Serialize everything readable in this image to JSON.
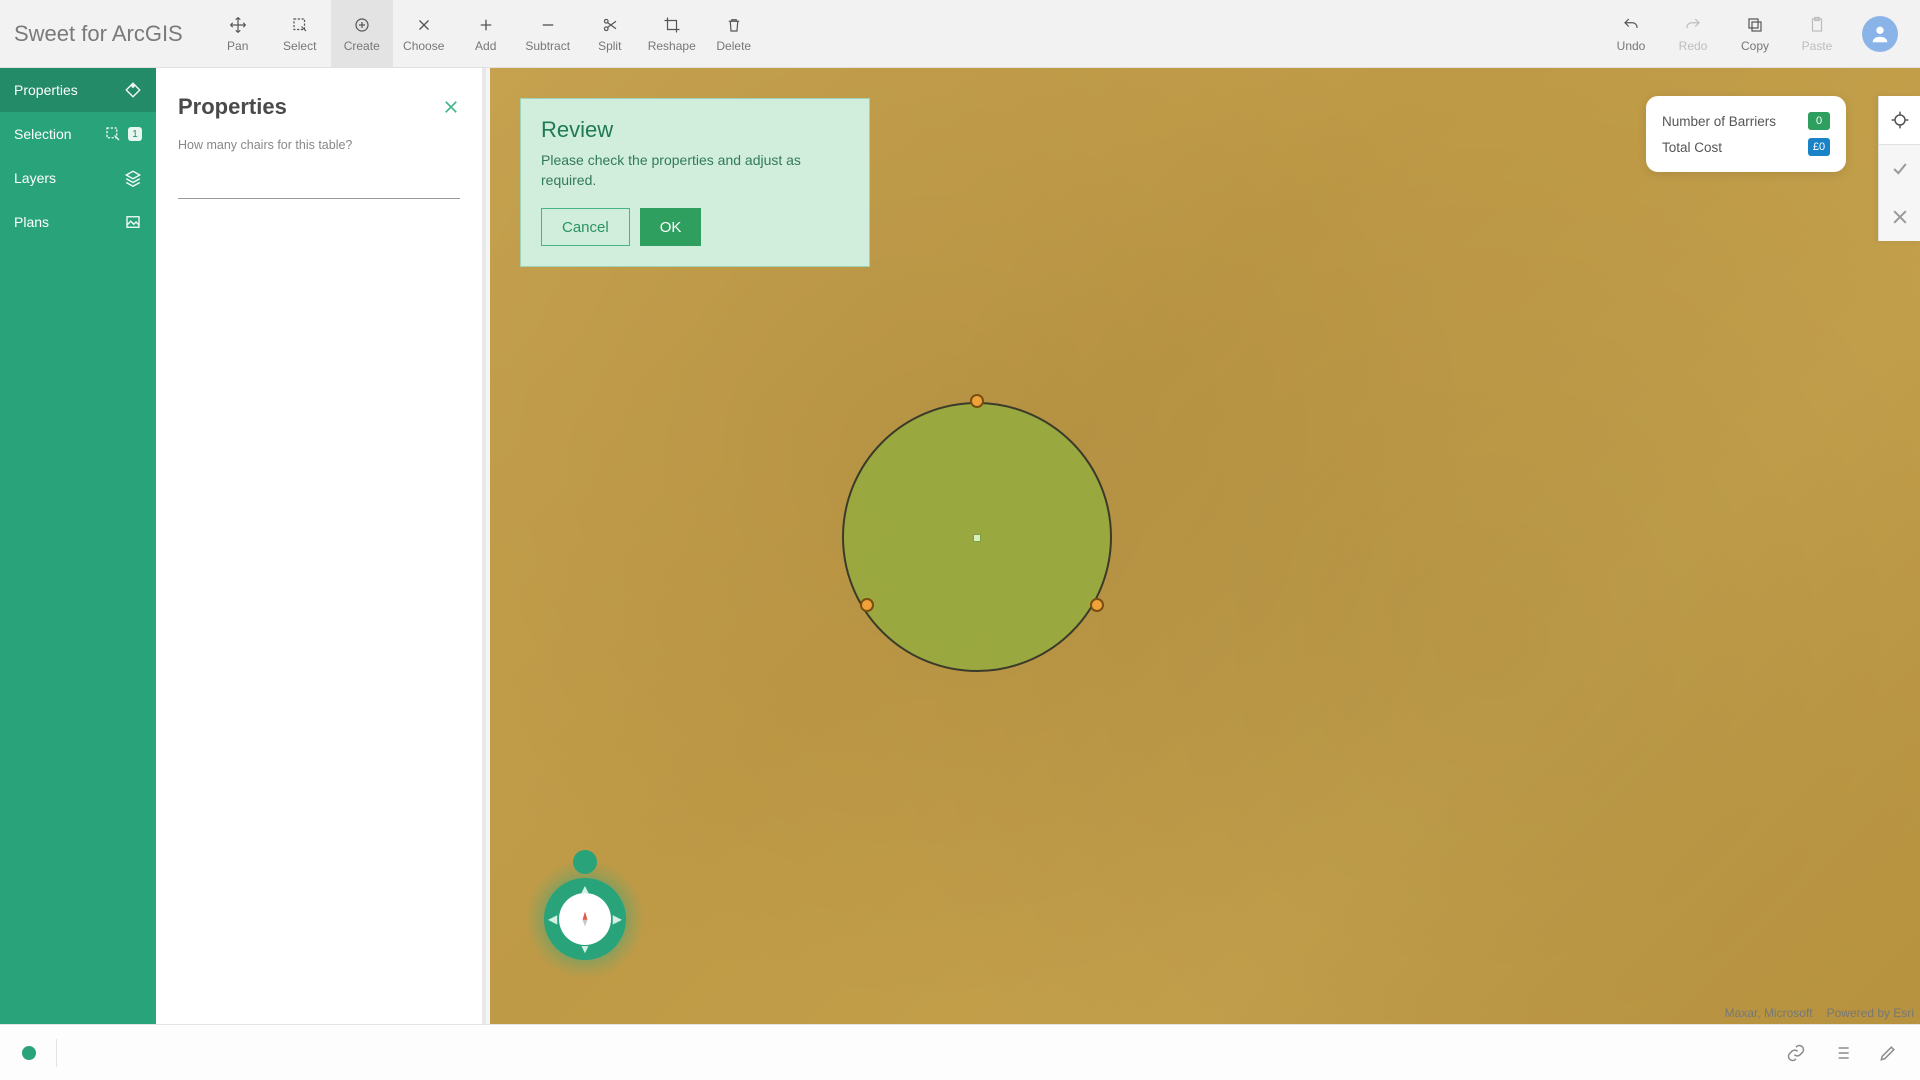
{
  "app_title": "Sweet for ArcGIS",
  "toolbar": {
    "left": [
      {
        "id": "pan",
        "label": "Pan"
      },
      {
        "id": "select",
        "label": "Select"
      },
      {
        "id": "create",
        "label": "Create",
        "active": true
      },
      {
        "id": "choose",
        "label": "Choose"
      },
      {
        "id": "add",
        "label": "Add"
      },
      {
        "id": "subtract",
        "label": "Subtract"
      },
      {
        "id": "split",
        "label": "Split"
      },
      {
        "id": "reshape",
        "label": "Reshape"
      },
      {
        "id": "delete",
        "label": "Delete"
      }
    ],
    "right": [
      {
        "id": "undo",
        "label": "Undo"
      },
      {
        "id": "redo",
        "label": "Redo",
        "muted": true
      },
      {
        "id": "copy",
        "label": "Copy"
      },
      {
        "id": "paste",
        "label": "Paste",
        "muted": true
      }
    ]
  },
  "sidebar": {
    "items": [
      {
        "id": "properties",
        "label": "Properties",
        "active": true
      },
      {
        "id": "selection",
        "label": "Selection",
        "badge": "1"
      },
      {
        "id": "layers",
        "label": "Layers"
      },
      {
        "id": "plans",
        "label": "Plans"
      }
    ]
  },
  "panel": {
    "title": "Properties",
    "field_label": "How many chairs for this table?",
    "field_value": ""
  },
  "popover": {
    "title": "Review",
    "body": "Please check the properties and adjust as required.",
    "cancel": "Cancel",
    "ok": "OK"
  },
  "info_card": {
    "rows": [
      {
        "label": "Number of Barriers",
        "value": "0",
        "style": "green"
      },
      {
        "label": "Total Cost",
        "value": "£0",
        "style": "blue"
      }
    ]
  },
  "attribution": {
    "sources": "Maxar, Microsoft",
    "powered": "Powered by Esri"
  }
}
